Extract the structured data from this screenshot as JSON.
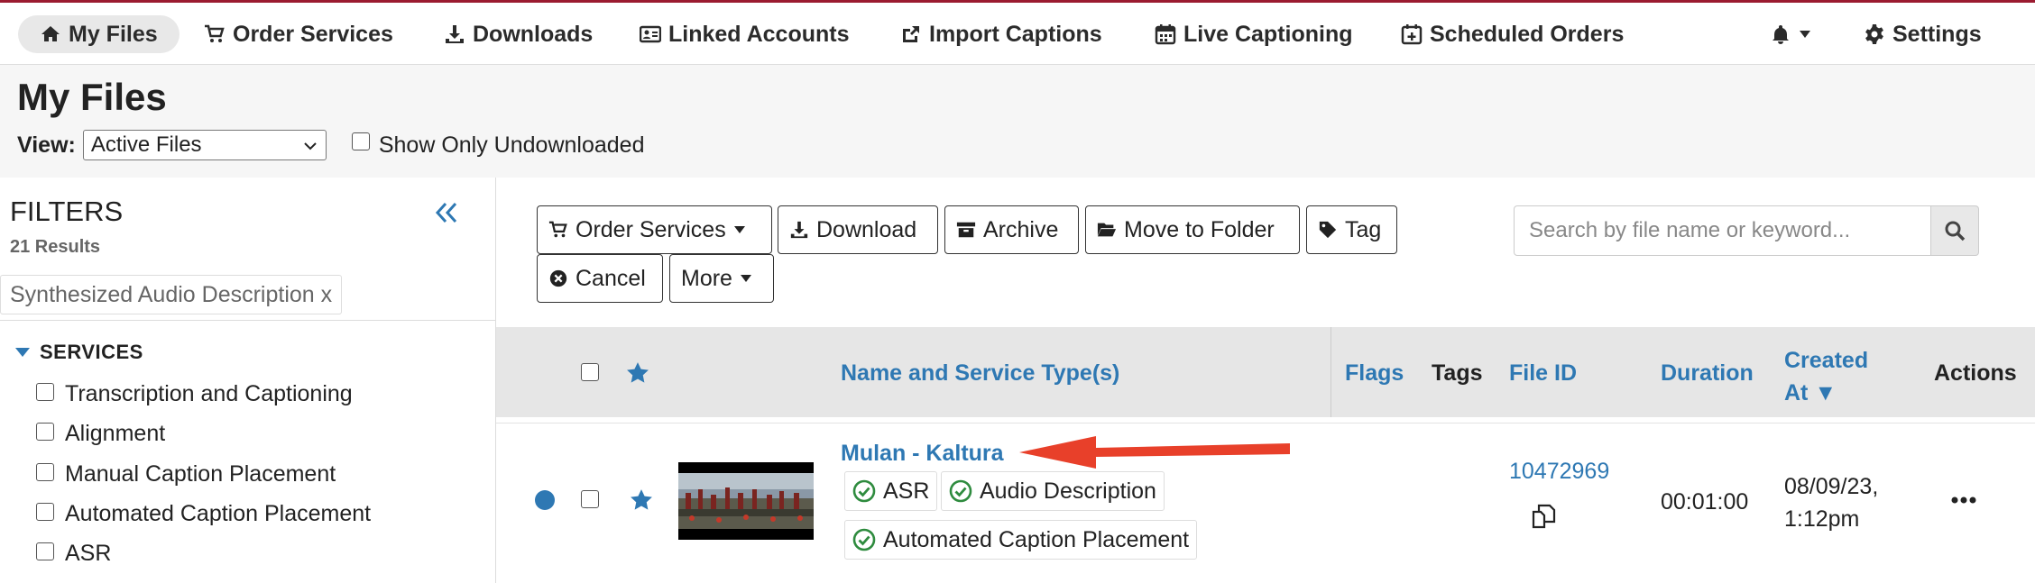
{
  "nav": {
    "items": [
      {
        "label": "My Files",
        "icon": "home-icon"
      },
      {
        "label": "Order Services",
        "icon": "cart-icon"
      },
      {
        "label": "Downloads",
        "icon": "download-icon"
      },
      {
        "label": "Linked Accounts",
        "icon": "id-card-icon"
      },
      {
        "label": "Import Captions",
        "icon": "share-icon"
      },
      {
        "label": "Live Captioning",
        "icon": "calendar-icon"
      },
      {
        "label": "Scheduled Orders",
        "icon": "calendar-plus-icon"
      }
    ],
    "settings_label": "Settings"
  },
  "page": {
    "title": "My Files",
    "view_label": "View:",
    "view_value": "Active Files",
    "show_undownloaded_label": "Show Only Undownloaded"
  },
  "sidebar": {
    "title": "FILTERS",
    "results": "21 Results",
    "active_filter": "Synthesized Audio Description x",
    "services_heading": "SERVICES",
    "services": [
      "Transcription and Captioning",
      "Alignment",
      "Manual Caption Placement",
      "Automated Caption Placement",
      "ASR"
    ]
  },
  "toolbar": {
    "order_services": "Order Services",
    "download": "Download",
    "archive": "Archive",
    "move_to_folder": "Move to Folder",
    "tag": "Tag",
    "cancel": "Cancel",
    "more": "More",
    "search_placeholder": "Search by file name or keyword..."
  },
  "table": {
    "headers": {
      "name": "Name and Service Type(s)",
      "flags": "Flags",
      "tags": "Tags",
      "file_id": "File ID",
      "duration": "Duration",
      "created_at": "Created At ▼",
      "actions": "Actions"
    },
    "rows": [
      {
        "name": "Mulan - Kaltura",
        "services": [
          "ASR",
          "Audio Description",
          "Automated Caption Placement"
        ],
        "file_id": "10472969",
        "duration": "00:01:00",
        "created_date": "08/09/23,",
        "created_time": "1:12pm"
      }
    ]
  },
  "colors": {
    "link": "#2e78b3",
    "success": "#2e8b3e",
    "annotation_arrow": "#e8402a"
  }
}
